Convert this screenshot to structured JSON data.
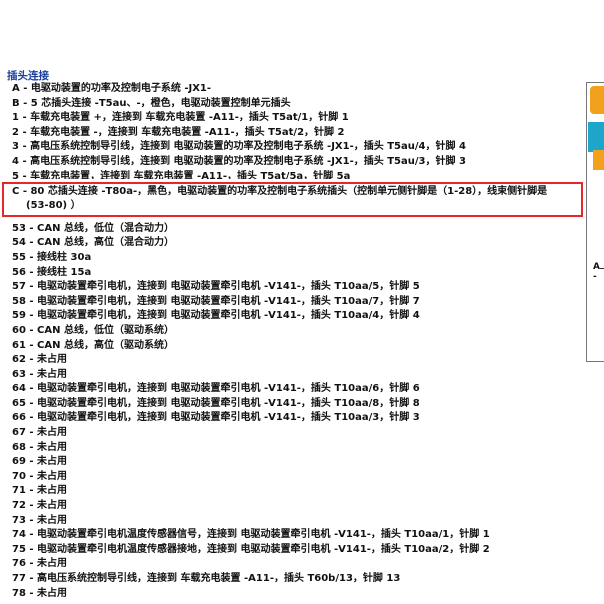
{
  "section_title": "插头连接",
  "rows_before": [
    {
      "key": "A -",
      "desc": "电驱动装置的功率及控制电子系统 -JX1-"
    },
    {
      "key": "B -",
      "desc": "5 芯插头连接 -T5au、-，橙色，电驱动装置控制单元插头"
    },
    {
      "key": "1 -",
      "desc": "车载充电装置 +，连接到 车载充电装置 -A11-，插头 T5at/1，针脚 1"
    },
    {
      "key": "2 -",
      "desc": "车载充电装置 -，连接到 车载充电装置 -A11-，插头 T5at/2，针脚 2"
    },
    {
      "key": "3 -",
      "desc": "高电压系统控制导引线，连接到 电驱动装置的功率及控制电子系统 -JX1-，插头 T5au/4，针脚 4"
    },
    {
      "key": "4 -",
      "desc": "高电压系统控制导引线，连接到 电驱动装置的功率及控制电子系统 -JX1-，插头 T5au/3，针脚 3"
    },
    {
      "key": "5 -",
      "desc": "车载充电装置，连接到 车载充电装置 -A11-，插头 T5at/5a，针脚 5a"
    }
  ],
  "highlight": {
    "key": "C -",
    "desc": "80 芯插头连接 -T80a-，黑色，电驱动装置的功率及控制电子系统插头（控制单元侧针脚是（1-28），线束侧针脚是",
    "cont": "(53-80) ）"
  },
  "rows_after": [
    {
      "key": "53 -",
      "desc": "CAN 总线，低位（混合动力）"
    },
    {
      "key": "54 -",
      "desc": "CAN 总线，高位（混合动力）"
    },
    {
      "key": "55 -",
      "desc": "接线柱 30a"
    },
    {
      "key": "56 -",
      "desc": "接线柱 15a"
    },
    {
      "key": "57 -",
      "desc": "电驱动装置牵引电机，连接到 电驱动装置牵引电机 -V141-，插头 T10aa/5，针脚 5"
    },
    {
      "key": "58 -",
      "desc": "电驱动装置牵引电机，连接到 电驱动装置牵引电机 -V141-，插头 T10aa/7，针脚 7"
    },
    {
      "key": "59 -",
      "desc": "电驱动装置牵引电机，连接到 电驱动装置牵引电机 -V141-，插头 T10aa/4，针脚 4"
    },
    {
      "key": "60 -",
      "desc": "CAN 总线，低位（驱动系统）"
    },
    {
      "key": "61 -",
      "desc": "CAN 总线，高位（驱动系统）"
    },
    {
      "key": "62 -",
      "desc": "未占用"
    },
    {
      "key": "63 -",
      "desc": "未占用"
    },
    {
      "key": "64 -",
      "desc": "电驱动装置牵引电机，连接到 电驱动装置牵引电机 -V141-，插头 T10aa/6，针脚 6"
    },
    {
      "key": "65 -",
      "desc": "电驱动装置牵引电机，连接到 电驱动装置牵引电机 -V141-，插头 T10aa/8，针脚 8"
    },
    {
      "key": "66 -",
      "desc": "电驱动装置牵引电机，连接到 电驱动装置牵引电机 -V141-，插头 T10aa/3，针脚 3"
    },
    {
      "key": "67 -",
      "desc": "未占用"
    },
    {
      "key": "68 -",
      "desc": "未占用"
    },
    {
      "key": "69 -",
      "desc": "未占用"
    },
    {
      "key": "70 -",
      "desc": "未占用"
    },
    {
      "key": "71 -",
      "desc": "未占用"
    },
    {
      "key": "72 -",
      "desc": "未占用"
    },
    {
      "key": "73 -",
      "desc": "未占用"
    },
    {
      "key": "74 -",
      "desc": "电驱动装置牵引电机温度传感器信号，连接到 电驱动装置牵引电机 -V141-，插头 T10aa/1，针脚 1"
    },
    {
      "key": "75 -",
      "desc": "电驱动装置牵引电机温度传感器接地，连接到 电驱动装置牵引电机 -V141-，插头 T10aa/2，针脚 2"
    },
    {
      "key": "76 -",
      "desc": "未占用"
    },
    {
      "key": "77 -",
      "desc": "高电压系统控制导引线，连接到 车载充电装置 -A11-，插头 T60b/13，针脚 13"
    },
    {
      "key": "78 -",
      "desc": "未占用"
    }
  ],
  "side_label": "A -",
  "colors": {
    "title": "#1a3f9c",
    "highlight_border": "#e5262b"
  }
}
